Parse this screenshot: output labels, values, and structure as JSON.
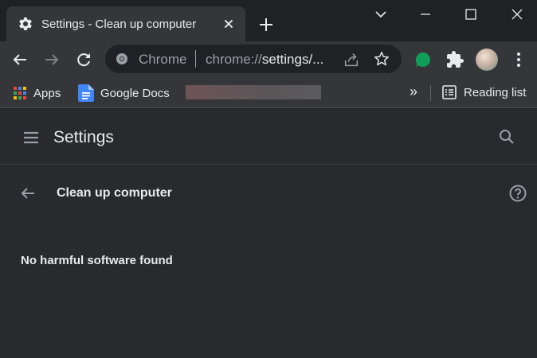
{
  "tab": {
    "title": "Settings - Clean up computer"
  },
  "omnibox": {
    "chip": "Chrome",
    "url_scheme": "chrome://",
    "url_path": "settings/..."
  },
  "bookmarks": {
    "items": [
      {
        "label": "Apps",
        "icon": "apps-grid-icon"
      },
      {
        "label": "Google Docs",
        "icon": "google-docs-icon"
      }
    ],
    "overflow": "»",
    "reading_list": "Reading list"
  },
  "settings": {
    "title": "Settings"
  },
  "page": {
    "heading": "Clean up computer",
    "status": "No harmful software found"
  },
  "colors": {
    "background": "#202124",
    "surface": "#292a2d",
    "toolbar": "#35363a",
    "text": "#e8eaed",
    "muted": "#9aa0a6",
    "extension_green": "#0f9d58"
  }
}
